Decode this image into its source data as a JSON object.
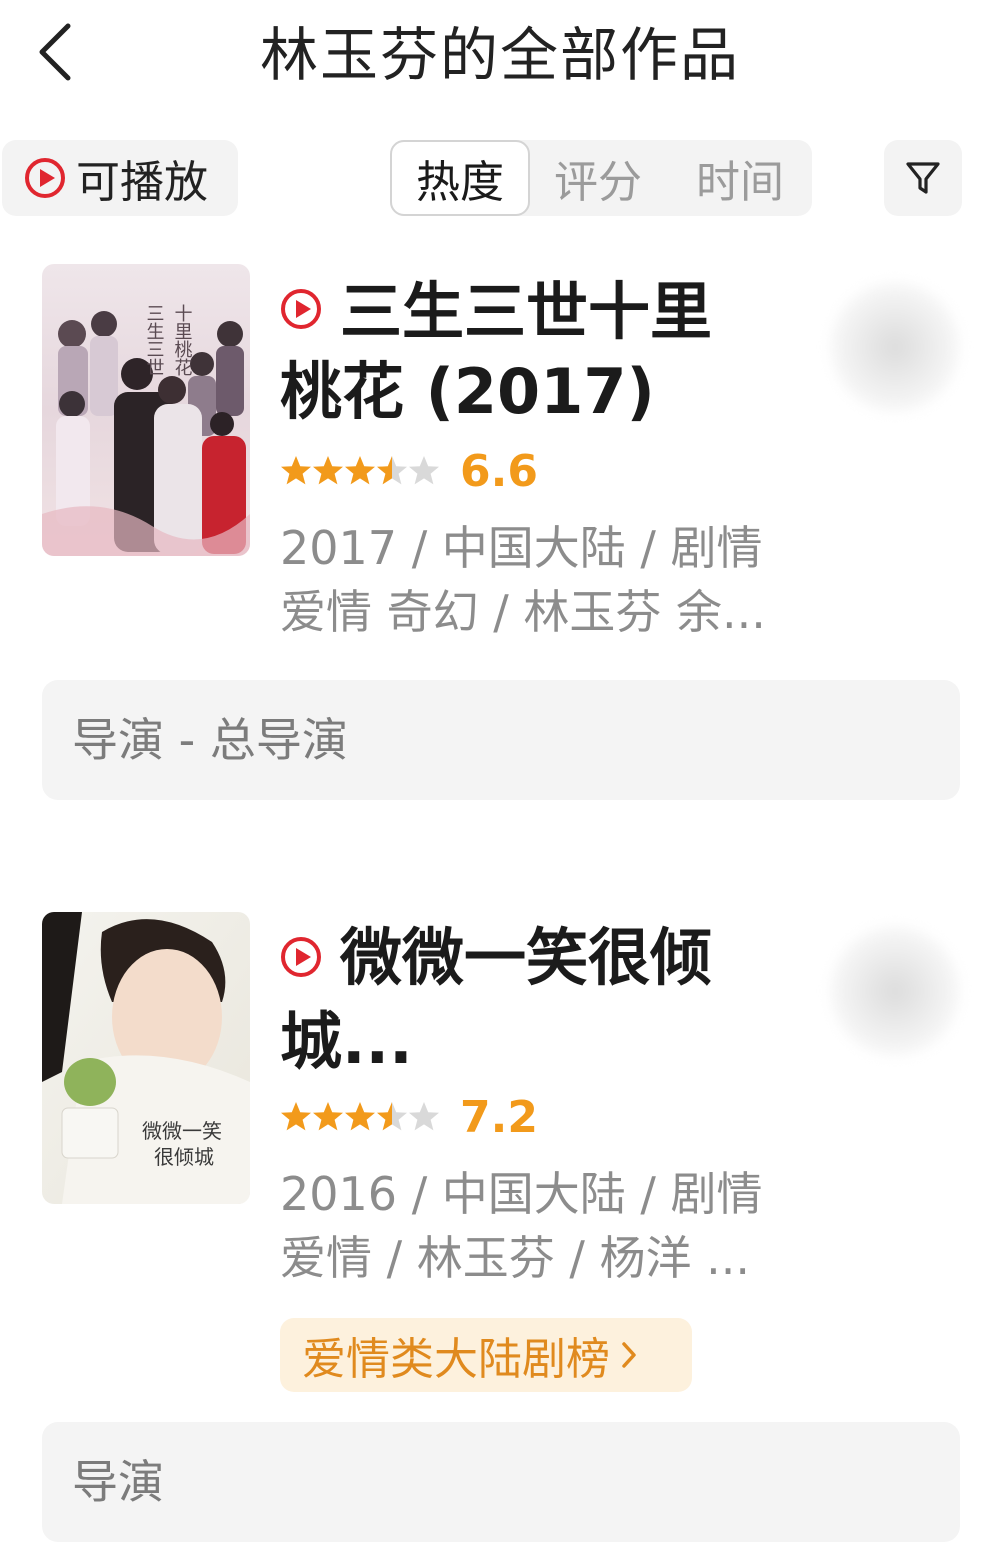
{
  "header": {
    "title": "林玉芬的全部作品",
    "back_icon": "chevron-left-icon"
  },
  "toolbar": {
    "playable_label": "可播放",
    "sort_tabs": [
      {
        "label": "热度",
        "active": true
      },
      {
        "label": "评分",
        "active": false
      },
      {
        "label": "时间",
        "active": false
      }
    ],
    "filter_icon": "filter-funnel-icon"
  },
  "works": [
    {
      "title_line1": "三生三世十里",
      "title_line2": "桃花 (2017)",
      "rating": "6.6",
      "stars": 3.5,
      "meta_line1": "2017 / 中国大陆 / 剧情",
      "meta_line2": "爱情 奇幻 / 林玉芬 余...",
      "role": "导演 - 总导演",
      "poster_text": "三生三世十里桃花"
    },
    {
      "title_line1": "微微一笑很倾",
      "title_line2": "城...",
      "rating": "7.2",
      "stars": 3.5,
      "meta_line1": "2016 / 中国大陆 / 剧情",
      "meta_line2": "爱情 / 林玉芬 / 杨洋 ...",
      "rank_badge": "爱情类大陆剧榜",
      "role": "导演",
      "poster_text": "微微一笑很倾城"
    }
  ],
  "colors": {
    "accent_red": "#e0262f",
    "rating_orange": "#f29a1b",
    "badge_bg": "#fdf1dd",
    "badge_text": "#e08a1e"
  }
}
